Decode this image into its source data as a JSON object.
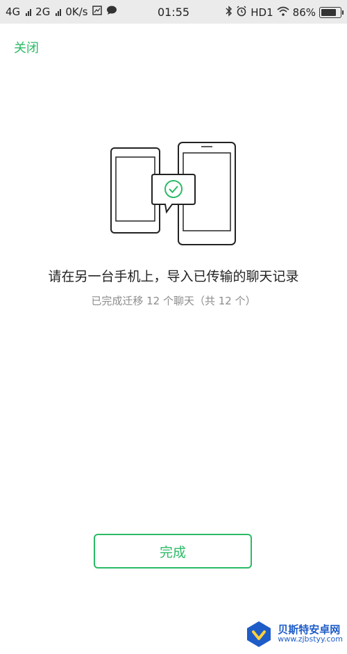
{
  "status_bar": {
    "net1": "4G",
    "net2": "2G",
    "speed": "0K/s",
    "time": "01:55",
    "hd": "HD1",
    "battery": "86%"
  },
  "header": {
    "close_label": "关闭"
  },
  "main": {
    "title": "请在另一台手机上，导入已传输的聊天记录",
    "subtitle": "已完成迁移 12 个聊天（共 12 个）"
  },
  "footer": {
    "done_label": "完成"
  },
  "watermark": {
    "name": "贝斯特安卓网",
    "url": "www.zjbstyy.com"
  },
  "colors": {
    "accent": "#2aba65",
    "status_bg": "#ebebeb",
    "watermark": "#1e5cc8"
  }
}
